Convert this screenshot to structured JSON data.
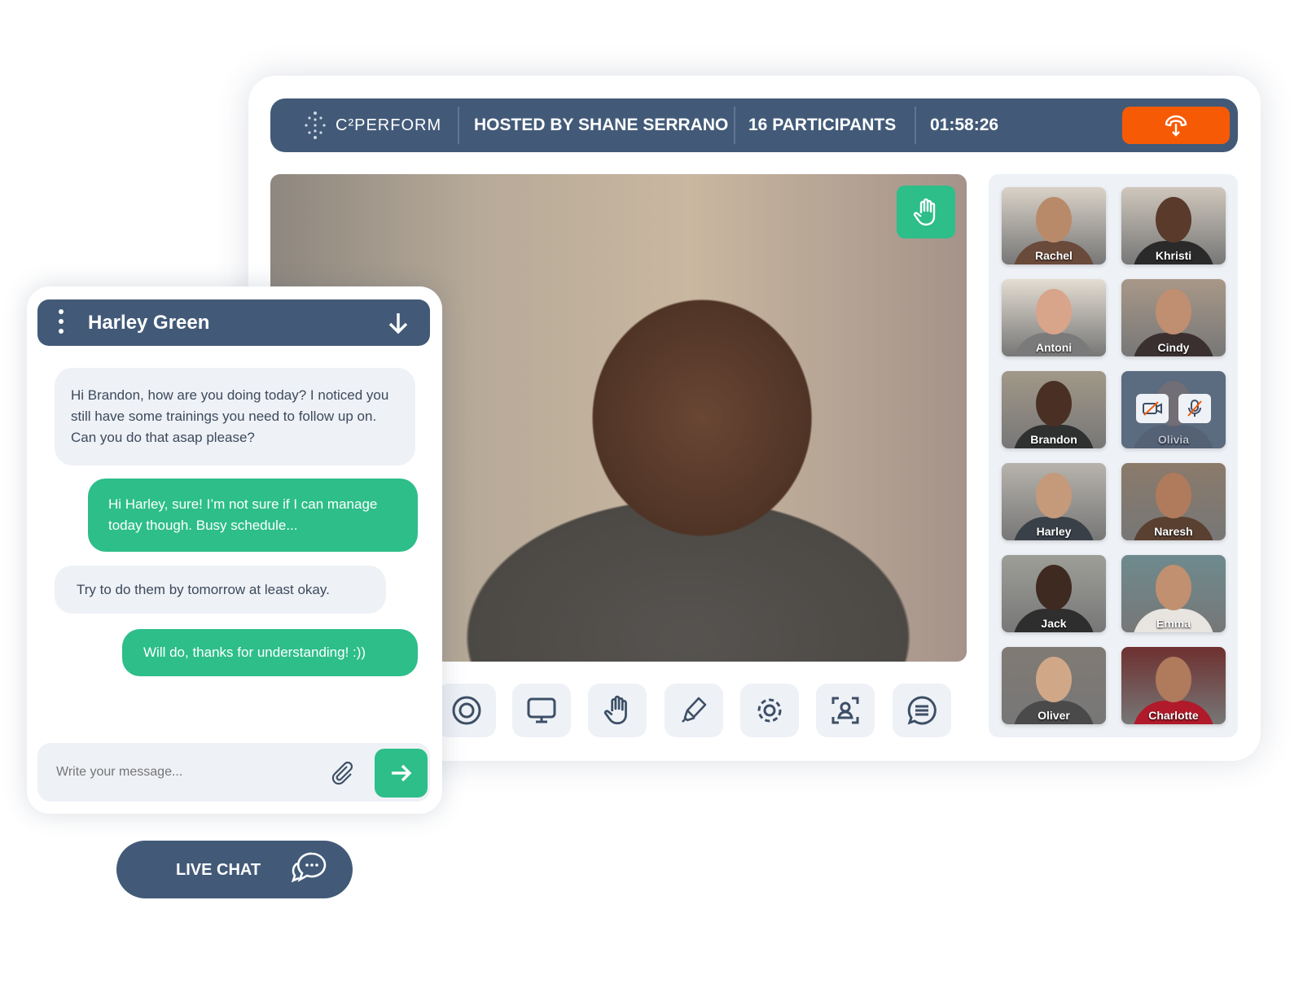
{
  "header": {
    "logo": "C²PERFORM",
    "host": "HOSTED BY SHANE SERRANO",
    "participants": "16 PARTICIPANTS",
    "timer": "01:58:26",
    "hangup_icon": "phone-hangup-icon"
  },
  "video": {
    "raise_hand_icon": "hand-icon"
  },
  "toolbar": [
    "record-icon",
    "screen-share-icon",
    "hand-icon",
    "pen-icon",
    "settings-icon",
    "focus-user-icon",
    "chat-icon"
  ],
  "participants": [
    {
      "name": "Rachel"
    },
    {
      "name": "Khristi"
    },
    {
      "name": "Antoni"
    },
    {
      "name": "Cindy"
    },
    {
      "name": "Brandon"
    },
    {
      "name": "Olivia",
      "camera_off": true,
      "muted": true
    },
    {
      "name": "Harley"
    },
    {
      "name": "Naresh"
    },
    {
      "name": "Jack"
    },
    {
      "name": "Emma"
    },
    {
      "name": "Oliver"
    },
    {
      "name": "Charlotte"
    }
  ],
  "chat": {
    "title": "Harley Green",
    "messages": [
      {
        "from": "them",
        "text": "Hi Brandon, how are you doing today? I noticed you still have some trainings you need to follow up on. Can you do that asap please?"
      },
      {
        "from": "me",
        "text": "Hi Harley, sure! I’m not sure if I can manage today though. Busy schedule..."
      },
      {
        "from": "them",
        "text": "Try to do them by tomorrow at least okay."
      },
      {
        "from": "me",
        "text": "Will do, thanks for understanding! :))"
      }
    ],
    "placeholder": "Write your message..."
  },
  "live_chat": "LIVE CHAT",
  "colors": {
    "navy": "#425a78",
    "green": "#2dbe8a",
    "orange": "#f75a05"
  }
}
